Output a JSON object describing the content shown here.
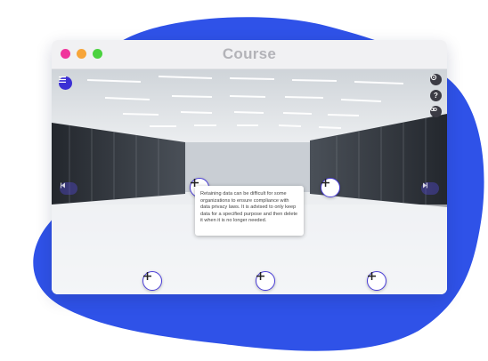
{
  "window": {
    "title": "Course",
    "dots": {
      "close": "#f0359c",
      "minimize": "#f7a53a",
      "maximize": "#4bd23f"
    }
  },
  "colors": {
    "accent": "#3b2fd4",
    "blob": "#2f52e8"
  },
  "icons": {
    "menu": "hamburger-menu-icon",
    "tools": [
      "settings-icon",
      "help-icon",
      "link-icon"
    ],
    "hotspot": "plus-icon",
    "play": "play-icon",
    "prev": "previous-icon",
    "next": "next-icon"
  },
  "help_label": "?",
  "tooltip": {
    "text": "Retaining data can be difficult for some organizations to ensure compliance with data privacy laws. It is advised to only keep data for a specified purpose and then delete it when it is no longer needed."
  }
}
